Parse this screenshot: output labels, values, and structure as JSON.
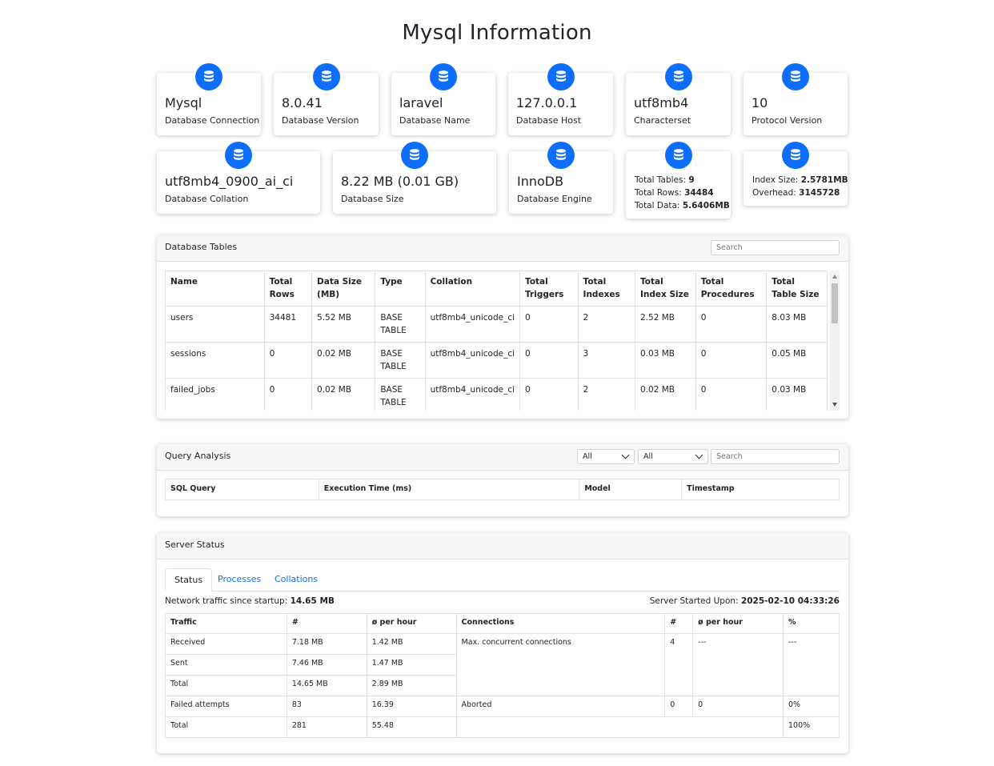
{
  "page": {
    "title": "Mysql Information"
  },
  "theme": {
    "accent": "#0d6efd",
    "border": "#dee2e6",
    "header_bg": "#f7f7f7"
  },
  "info_cards": [
    {
      "icon": "database-icon",
      "value": "Mysql",
      "label": "Database Connection"
    },
    {
      "icon": "database-icon",
      "value": "8.0.41",
      "label": "Database Version"
    },
    {
      "icon": "database-icon",
      "value": "laravel",
      "label": "Database Name"
    },
    {
      "icon": "database-icon",
      "value": "127.0.0.1",
      "label": "Database Host"
    },
    {
      "icon": "database-icon",
      "value": "utf8mb4",
      "label": "Characterset"
    },
    {
      "icon": "database-icon",
      "value": "10",
      "label": "Protocol Version"
    },
    {
      "icon": "database-icon",
      "value": "utf8mb4_0900_ai_ci",
      "label": "Database Collation"
    },
    {
      "icon": "database-icon",
      "value": "8.22 MB (0.01 GB)",
      "label": "Database Size"
    },
    {
      "icon": "database-icon",
      "value": "InnoDB",
      "label": "Database Engine"
    }
  ],
  "totals_card": {
    "icon": "database-icon",
    "tables_label": "Total Tables:",
    "tables_value": "9",
    "rows_label": "Total Rows:",
    "rows_value": "34484",
    "data_label": "Total Data:",
    "data_value": "5.6406MB"
  },
  "index_card": {
    "icon": "database-icon",
    "index_label": "Index Size:",
    "index_value": "2.5781MB",
    "overhead_label": "Overhead:",
    "overhead_value": "3145728"
  },
  "tables_panel": {
    "title": "Database Tables",
    "search_placeholder": "Search",
    "headers": [
      "Name",
      "Total Rows",
      "Data Size (MB)",
      "Type",
      "Collation",
      "Total Triggers",
      "Total Indexes",
      "Total Index Size",
      "Total Procedures",
      "Total Table Size"
    ],
    "rows": [
      [
        "users",
        "34481",
        "5.52 MB",
        "BASE TABLE",
        "utf8mb4_unicode_ci",
        "0",
        "2",
        "2.52 MB",
        "0",
        "8.03 MB"
      ],
      [
        "sessions",
        "0",
        "0.02 MB",
        "BASE TABLE",
        "utf8mb4_unicode_ci",
        "0",
        "3",
        "0.03 MB",
        "0",
        "0.05 MB"
      ],
      [
        "failed_jobs",
        "0",
        "0.02 MB",
        "BASE TABLE",
        "utf8mb4_unicode_ci",
        "0",
        "2",
        "0.02 MB",
        "0",
        "0.03 MB"
      ]
    ]
  },
  "query_panel": {
    "title": "Query Analysis",
    "filter1": "All",
    "filter2": "All",
    "search_placeholder": "Search",
    "headers": [
      "SQL Query",
      "Execution Time (ms)",
      "Model",
      "Timestamp"
    ]
  },
  "server_panel": {
    "title": "Server Status",
    "tabs": [
      "Status",
      "Processes",
      "Collations"
    ],
    "traffic_label": "Network traffic since startup:",
    "traffic_value": "14.65 MB",
    "started_label": "Server Started Upon:",
    "started_value": "2025-02-10 04:33:26",
    "traffic_headers": [
      "Traffic",
      "#",
      "ø per hour"
    ],
    "conn_headers": [
      "Connections",
      "#",
      "ø per hour",
      "%"
    ],
    "traffic_rows": [
      [
        "Received",
        "7.18 MB",
        "1.42 MB"
      ],
      [
        "Sent",
        "7.46 MB",
        "1.47 MB"
      ],
      [
        "Total",
        "14.65 MB",
        "2.89 MB"
      ],
      [
        "Failed attempts",
        "83",
        "16.39"
      ],
      [
        "Total",
        "281",
        "55.48"
      ]
    ],
    "conn_rows": [
      [
        "Max. concurrent connections",
        "4",
        "---",
        "---"
      ],
      [
        "Aborted",
        "0",
        "0",
        "0%"
      ],
      [
        "100%"
      ]
    ]
  }
}
